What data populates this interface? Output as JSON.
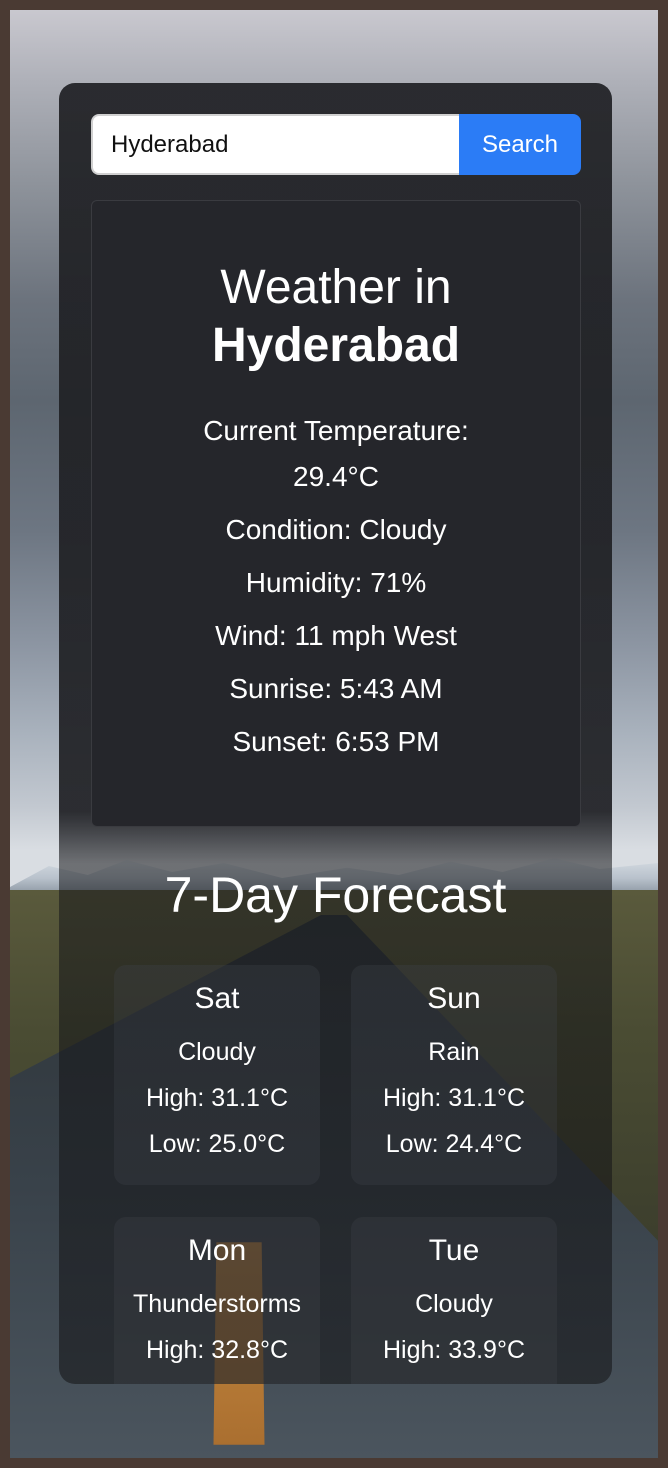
{
  "search": {
    "value": "Hyderabad",
    "button_label": "Search"
  },
  "current": {
    "title_prefix": "Weather in",
    "city": "Hyderabad",
    "temperature_label": "Current Temperature:",
    "temperature_value": "29.4°C",
    "condition": "Condition: Cloudy",
    "humidity": "Humidity: 71%",
    "wind": "Wind: 11 mph West",
    "sunrise": "Sunrise: 5:43 AM",
    "sunset": "Sunset: 6:53 PM"
  },
  "forecast": {
    "title": "7-Day Forecast",
    "days": [
      {
        "day": "Sat",
        "condition": "Cloudy",
        "high": "High: 31.1°C",
        "low": "Low: 25.0°C"
      },
      {
        "day": "Sun",
        "condition": "Rain",
        "high": "High: 31.1°C",
        "low": "Low: 24.4°C"
      },
      {
        "day": "Mon",
        "condition": "Thunderstorms",
        "high": "High: 32.8°C",
        "low": ""
      },
      {
        "day": "Tue",
        "condition": "Cloudy",
        "high": "High: 33.9°C",
        "low": ""
      }
    ]
  },
  "colors": {
    "accent": "#2b7cf6",
    "panel": "#25262b",
    "card": "#1a1b1f"
  }
}
